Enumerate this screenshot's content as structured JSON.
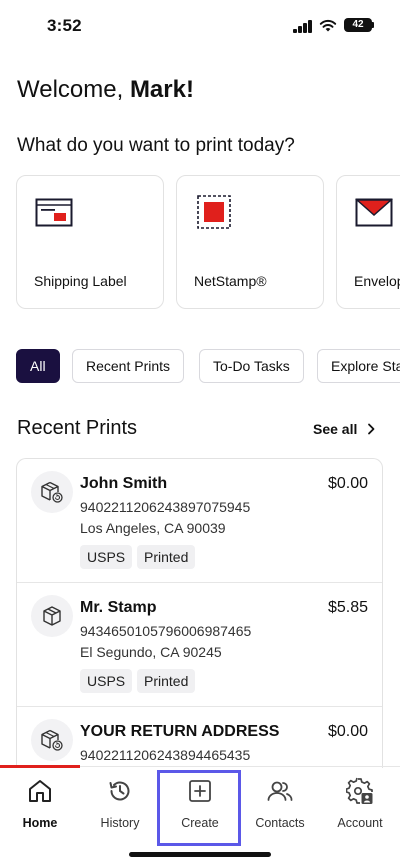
{
  "status_bar": {
    "time": "3:52",
    "battery": "42"
  },
  "greeting": {
    "prefix": "Welcome,",
    "name": "Mark!"
  },
  "question": "What do you want to print today?",
  "products": [
    {
      "label": "Shipping Label",
      "icon": "shipping-label-icon"
    },
    {
      "label": "NetStamp®",
      "icon": "netstamp-icon"
    },
    {
      "label": "Envelop",
      "icon": "envelope-icon"
    }
  ],
  "filters": [
    {
      "label": "All",
      "active": true
    },
    {
      "label": "Recent Prints",
      "active": false
    },
    {
      "label": "To-Do Tasks",
      "active": false
    },
    {
      "label": "Explore Sta",
      "active": false
    }
  ],
  "recent_prints": {
    "title": "Recent Prints",
    "see_all": "See all",
    "items": [
      {
        "name": "John Smith",
        "price": "$0.00",
        "tracking": "9402211206243897075945",
        "address": "Los Angeles, CA 90039",
        "tags": [
          "USPS",
          "Printed"
        ],
        "icon": "package-return-icon"
      },
      {
        "name": "Mr. Stamp",
        "price": "$5.85",
        "tracking": "9434650105796006987465",
        "address": "El Segundo, CA 90245",
        "tags": [
          "USPS",
          "Printed"
        ],
        "icon": "package-icon"
      },
      {
        "name": "YOUR RETURN ADDRESS",
        "price": "$0.00",
        "tracking": "9402211206243894465435",
        "address": "",
        "tags": [],
        "icon": "package-return-icon"
      }
    ]
  },
  "nav": [
    {
      "label": "Home",
      "icon": "home-icon",
      "active": true
    },
    {
      "label": "History",
      "icon": "history-icon",
      "active": false
    },
    {
      "label": "Create",
      "icon": "create-plus-icon",
      "active": false
    },
    {
      "label": "Contacts",
      "icon": "contacts-icon",
      "active": false
    },
    {
      "label": "Account",
      "icon": "account-settings-icon",
      "active": false
    }
  ],
  "colors": {
    "accent_red": "#e0201c",
    "chip_active_bg": "#1a1040",
    "highlight": "#5b58e8"
  }
}
